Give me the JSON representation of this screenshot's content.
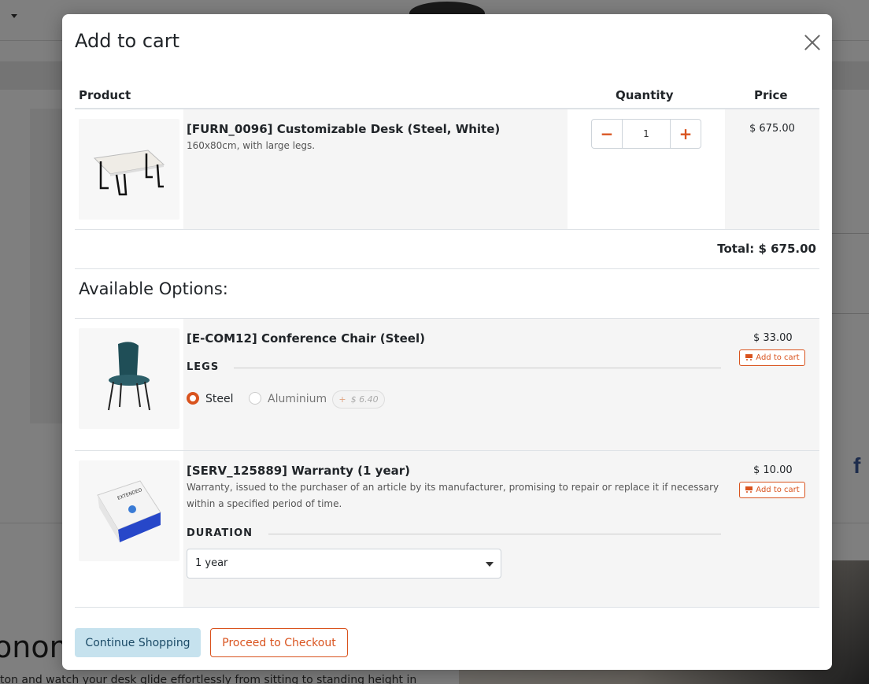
{
  "background": {
    "heading_fragment": "onom",
    "text_fragment": "ton and watch your desk glide effortlessly from sitting to standing height in",
    "facebook_glyph": "f"
  },
  "modal": {
    "title": "Add to cart",
    "close_icon": "close-icon",
    "columns": {
      "product": "Product",
      "quantity": "Quantity",
      "price": "Price"
    },
    "main_product": {
      "name": "[FURN_0096] Customizable Desk (Steel, White)",
      "description": "160x80cm, with large legs.",
      "quantity": "1",
      "price": "$ 675.00",
      "image": "desk-image"
    },
    "total": "Total: $ 675.00",
    "available_options_title": "Available Options:",
    "options": [
      {
        "name": "[E-COM12] Conference Chair (Steel)",
        "price": "$ 33.00",
        "add_label": "Add to cart",
        "image": "chair-image",
        "attribute": "LEGS",
        "values": [
          {
            "label": "Steel",
            "selected": true
          },
          {
            "label": "Aluminium",
            "selected": false,
            "extra_sign": "+",
            "extra": "$ 6.40"
          }
        ]
      },
      {
        "name": "[SERV_125889] Warranty (1 year)",
        "description": "Warranty, issued to the purchaser of an article by its manufacturer, promising to repair or replace it if necessary within a specified period of time.",
        "price": "$ 10.00",
        "add_label": "Add to cart",
        "image": "warranty-box-image",
        "attribute": "DURATION",
        "selected_value": "1 year"
      }
    ],
    "buttons": {
      "continue": "Continue Shopping",
      "checkout": "Proceed to Checkout"
    }
  },
  "colors": {
    "accent": "#d9531e",
    "secondary_button_bg": "#c6e2ee",
    "overlay": "rgba(0,0,0,0.5)"
  }
}
